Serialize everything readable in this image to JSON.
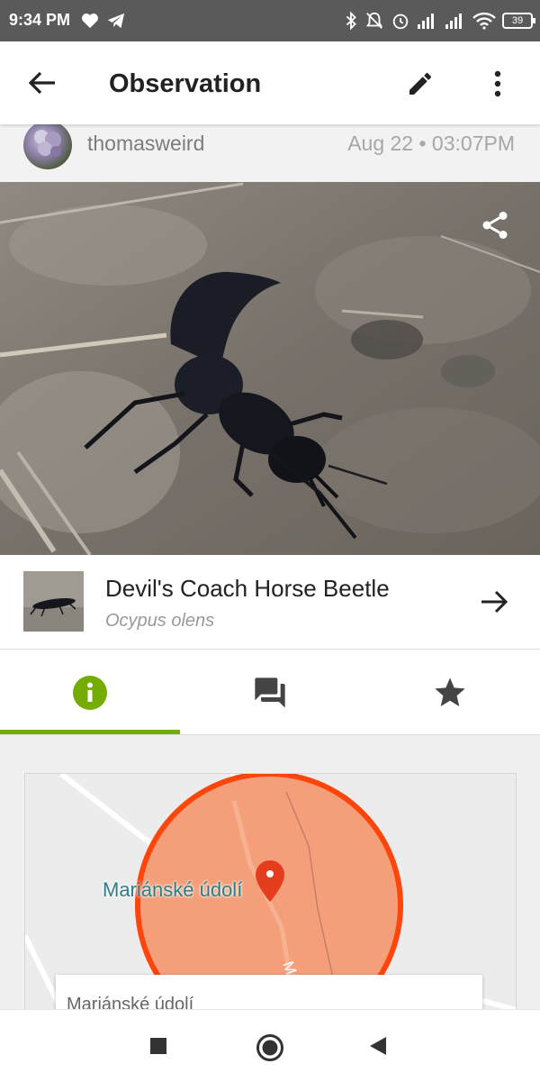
{
  "status_bar": {
    "time": "9:34 PM",
    "left_icons": [
      "heart-icon",
      "telegram-icon"
    ],
    "right_icons": [
      "bluetooth-icon",
      "mute-icon",
      "alarm-icon",
      "signal-icon",
      "signal-icon",
      "wifi-icon"
    ],
    "battery": "39"
  },
  "app_bar": {
    "title": "Observation",
    "back_icon": "arrow-left-icon",
    "edit_icon": "pencil-icon",
    "menu_icon": "more-vertical-icon"
  },
  "observer": {
    "username": "thomasweird",
    "datetime": "Aug 22 • 03:07PM"
  },
  "photo": {
    "share_icon": "share-icon"
  },
  "taxon": {
    "common_name": "Devil's Coach Horse Beetle",
    "scientific_name": "Ocypus olens",
    "open_icon": "arrow-right-icon"
  },
  "tabs": [
    {
      "name": "info",
      "icon": "info-icon",
      "active": true
    },
    {
      "name": "activity",
      "icon": "comments-icon",
      "active": false
    },
    {
      "name": "favorites",
      "icon": "star-icon",
      "active": false
    }
  ],
  "map": {
    "label": "Mariánské údolí",
    "road_label": "Ma",
    "accuracy_color": "#ff3d00",
    "pin_icon": "map-pin-icon"
  },
  "place_card": {
    "text": "Mariánské údolí"
  },
  "colors": {
    "accent": "#74ac00",
    "status_bar": "#5a5a5a"
  },
  "nav_bar": {
    "buttons": [
      "recents-square-icon",
      "home-circle-icon",
      "back-triangle-icon"
    ]
  }
}
